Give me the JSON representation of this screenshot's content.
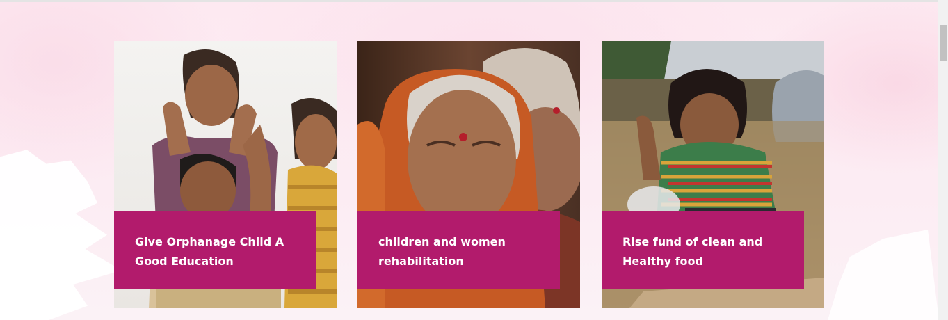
{
  "cards": [
    {
      "title": "Give Orphanage Child A Good Education",
      "photo": "children-waving-photo"
    },
    {
      "title": "children and women rehabilitation",
      "photo": "elderly-women-photo"
    },
    {
      "title": "Rise fund of clean and Healthy food",
      "photo": "child-playing-in-dirt-photo"
    }
  ],
  "colors": {
    "caption_background": "#b21b6c",
    "caption_text": "#ffffff",
    "page_background": "#fbeef3"
  }
}
